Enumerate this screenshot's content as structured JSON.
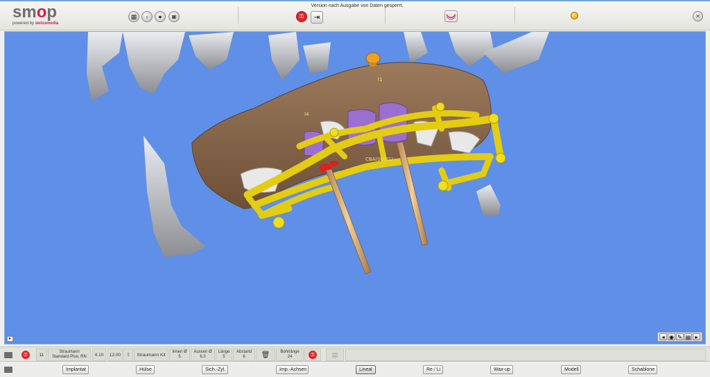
{
  "app": {
    "logo_main_pre": "sm",
    "logo_main_o": "o",
    "logo_main_post": "p",
    "logo_sub_pre": "powered by ",
    "logo_sub_brand": "swissmedia"
  },
  "topbar": {
    "version_notice": "Version nach Ausgabe von Daten gesperrt."
  },
  "viewport": {
    "labels": [
      "I1",
      "I4",
      "CBA(00:01)"
    ]
  },
  "infobar": {
    "position": "11",
    "implant_line1": "Straumann",
    "implant_line2": "Standard Plus, RN",
    "diameter": "4.10",
    "length": "12.00",
    "kit": "Straumann Kit",
    "innen_label": "Innen Ø",
    "innen_value": "5",
    "aussen_label": "Aussen Ø",
    "aussen_value": "6.3",
    "laenge_label": "Länge",
    "laenge_value": "5",
    "abstand_label": "Abstand",
    "abstand_value": "6",
    "bohrlaenge_label": "Bohrlänge",
    "bohrlaenge_value": "24"
  },
  "tabs": [
    {
      "label": "Implantat"
    },
    {
      "label": "Hülse"
    },
    {
      "label": "Sich.-Zyl."
    },
    {
      "label": "Imp.-Achsen"
    },
    {
      "label": "Lineal"
    },
    {
      "label": "Re / Li"
    },
    {
      "label": "Wax-up"
    },
    {
      "label": "Modell"
    },
    {
      "label": "Schablone"
    }
  ],
  "colors": {
    "viewport_bg": "#5f8fe6",
    "accent_red": "#c9234a",
    "gingiva": "#8c6b4f",
    "guide_yellow": "#e3cc12",
    "sleeve_purple": "#9b6fd0",
    "axis_pin": "#d9b07a"
  }
}
